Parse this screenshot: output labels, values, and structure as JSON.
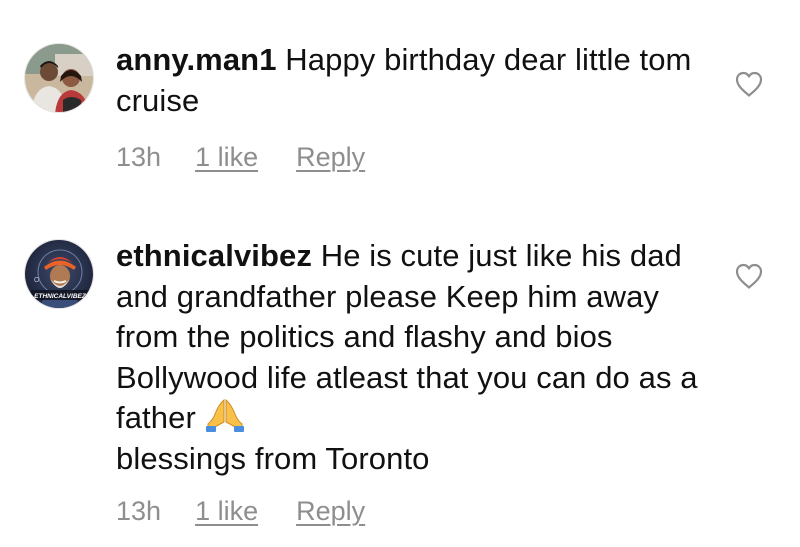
{
  "comments": [
    {
      "username": "anny.man1",
      "text": "Happy birthday dear little tom cruise",
      "time": "13h",
      "likes": "1 like",
      "reply_label": "Reply",
      "avatar_icon": "couple-photo-avatar",
      "like_icon": "heart-outline-icon"
    },
    {
      "username": "ethnicalvibez",
      "text": "He is cute just like his dad and grandfather please Keep him away from the politics and flashy and bios Bollywood life atleast that you can do as a father",
      "emoji": "folded-hands-icon",
      "text_end": "blessings from Toronto",
      "time": "13h",
      "likes": "1 like",
      "reply_label": "Reply",
      "avatar_logo_text": "ETHNICALVIBEZ",
      "avatar_icon": "ethnicalvibez-logo-avatar",
      "like_icon": "heart-outline-icon"
    }
  ],
  "colors": {
    "text": "#111111",
    "meta": "#8e8e8e",
    "background": "#ffffff"
  }
}
